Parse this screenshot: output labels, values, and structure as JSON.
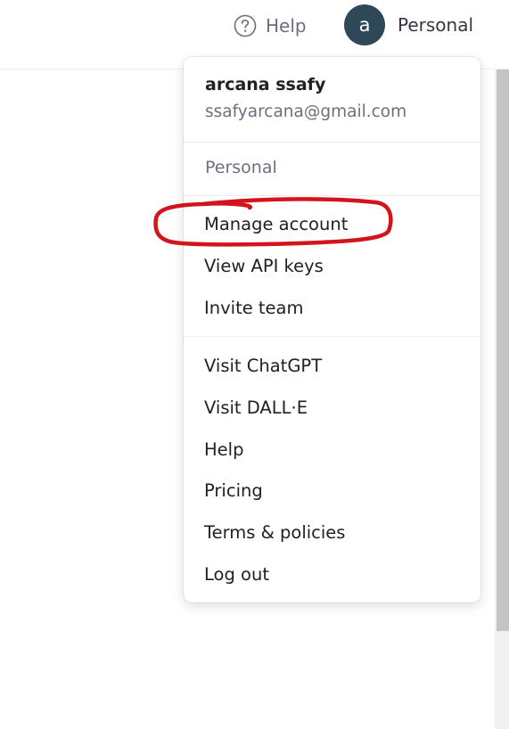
{
  "header": {
    "help_label": "Help",
    "avatar_initial": "a",
    "account_label": "Personal"
  },
  "menu": {
    "user_name": "arcana ssafy",
    "user_email": "ssafyarcana@gmail.com",
    "org_label": "Personal",
    "account_items": [
      {
        "label": "Manage account"
      },
      {
        "label": "View API keys"
      },
      {
        "label": "Invite team"
      }
    ],
    "link_items": [
      {
        "label": "Visit ChatGPT"
      },
      {
        "label": "Visit DALL·E"
      },
      {
        "label": "Help"
      },
      {
        "label": "Pricing"
      },
      {
        "label": "Terms & policies"
      },
      {
        "label": "Log out"
      }
    ]
  },
  "colors": {
    "avatar_bg": "#2f4858",
    "annotation_red": "#d4141c",
    "muted_text": "#6e6e80"
  },
  "icons": {
    "help": "question-circle-icon"
  }
}
